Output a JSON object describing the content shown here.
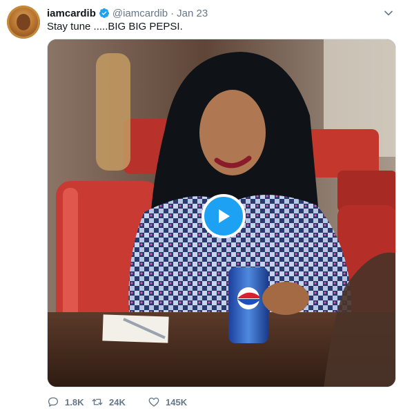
{
  "tweet": {
    "display_name": "iamcardib",
    "handle": "@iamcardib",
    "separator": "·",
    "date": "Jan 23",
    "text": "Stay tune .....BIG BIG PEPSI.",
    "verified": true,
    "verified_color": "#1da1f2"
  },
  "media": {
    "type": "video",
    "play_icon": "play-icon",
    "play_button_color": "#1da1f2"
  },
  "actions": {
    "replies": "1.8K",
    "retweets": "24K",
    "likes": "145K",
    "icon_color": "#657786"
  }
}
